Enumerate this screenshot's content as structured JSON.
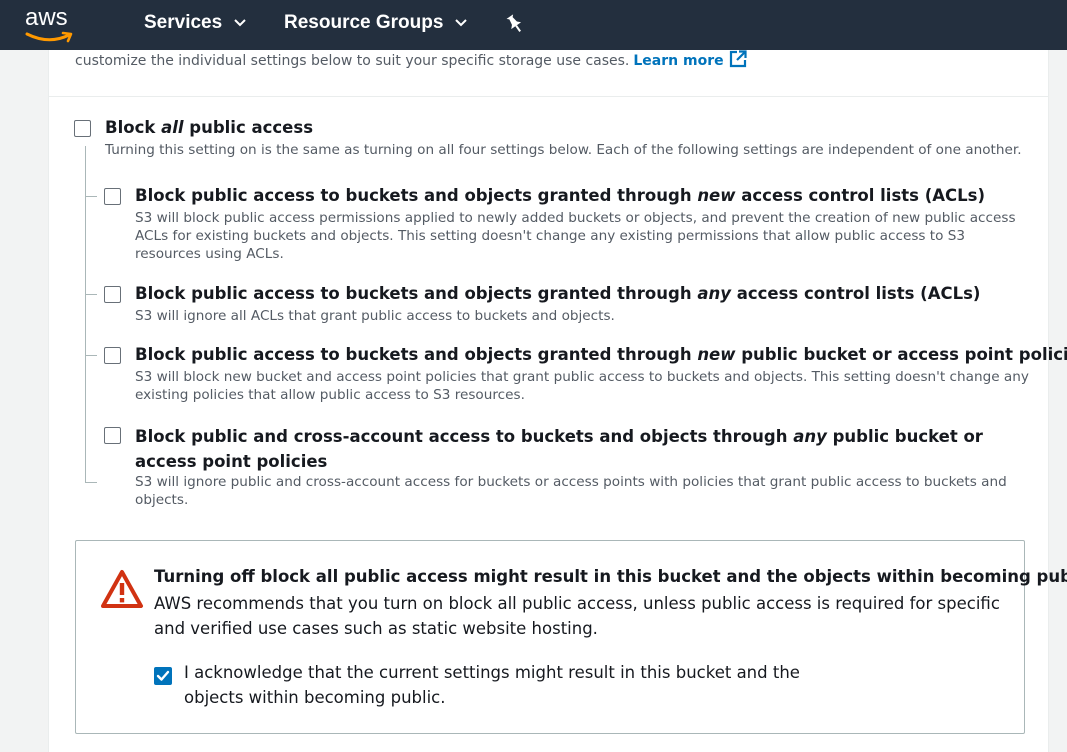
{
  "nav": {
    "logo_text": "aws",
    "services_label": "Services",
    "resource_groups_label": "Resource Groups"
  },
  "intro": {
    "text": "customize the individual settings below to suit your specific storage use cases.",
    "learn_more": "Learn more"
  },
  "block_all": {
    "title_pre": "Block ",
    "title_em": "all",
    "title_post": " public access",
    "description": "Turning this setting on is the same as turning on all four settings below. Each of the following settings are independent of one another.",
    "checked": false
  },
  "options": [
    {
      "title_pre": "Block public access to buckets and objects granted through ",
      "title_em": "new",
      "title_post": " access control lists (ACLs)",
      "description": "S3 will block public access permissions applied to newly added buckets or objects, and prevent the creation of new public access ACLs for existing buckets and objects. This setting doesn't change any existing permissions that allow public access to S3 resources using ACLs.",
      "checked": false
    },
    {
      "title_pre": "Block public access to buckets and objects granted through ",
      "title_em": "any",
      "title_post": " access control lists (ACLs)",
      "description": "S3 will ignore all ACLs that grant public access to buckets and objects.",
      "checked": false
    },
    {
      "title_pre": "Block public access to buckets and objects granted through ",
      "title_em": "new",
      "title_post": " public bucket or access point policies",
      "description": "S3 will block new bucket and access point policies that grant public access to buckets and objects. This setting doesn't change any existing policies that allow public access to S3 resources.",
      "checked": false
    },
    {
      "title_pre": "Block public and cross-account access to buckets and objects through ",
      "title_em": "any",
      "title_post": " public bucket or access point policies",
      "description": "S3 will ignore public and cross-account access for buckets or access points with policies that grant public access to buckets and objects.",
      "checked": false
    }
  ],
  "warning": {
    "title": "Turning off block all public access might result in this bucket and the objects within becoming public",
    "text": "AWS recommends that you turn on block all public access, unless public access is required for specific and verified use cases such as static website hosting.",
    "ack_label": "I acknowledge that the current settings might result in this bucket and the objects within becoming public.",
    "ack_checked": true
  },
  "colors": {
    "nav_bg": "#232f3e",
    "link": "#0073bb",
    "warning_red": "#d13212",
    "smile_orange": "#ff9900"
  }
}
